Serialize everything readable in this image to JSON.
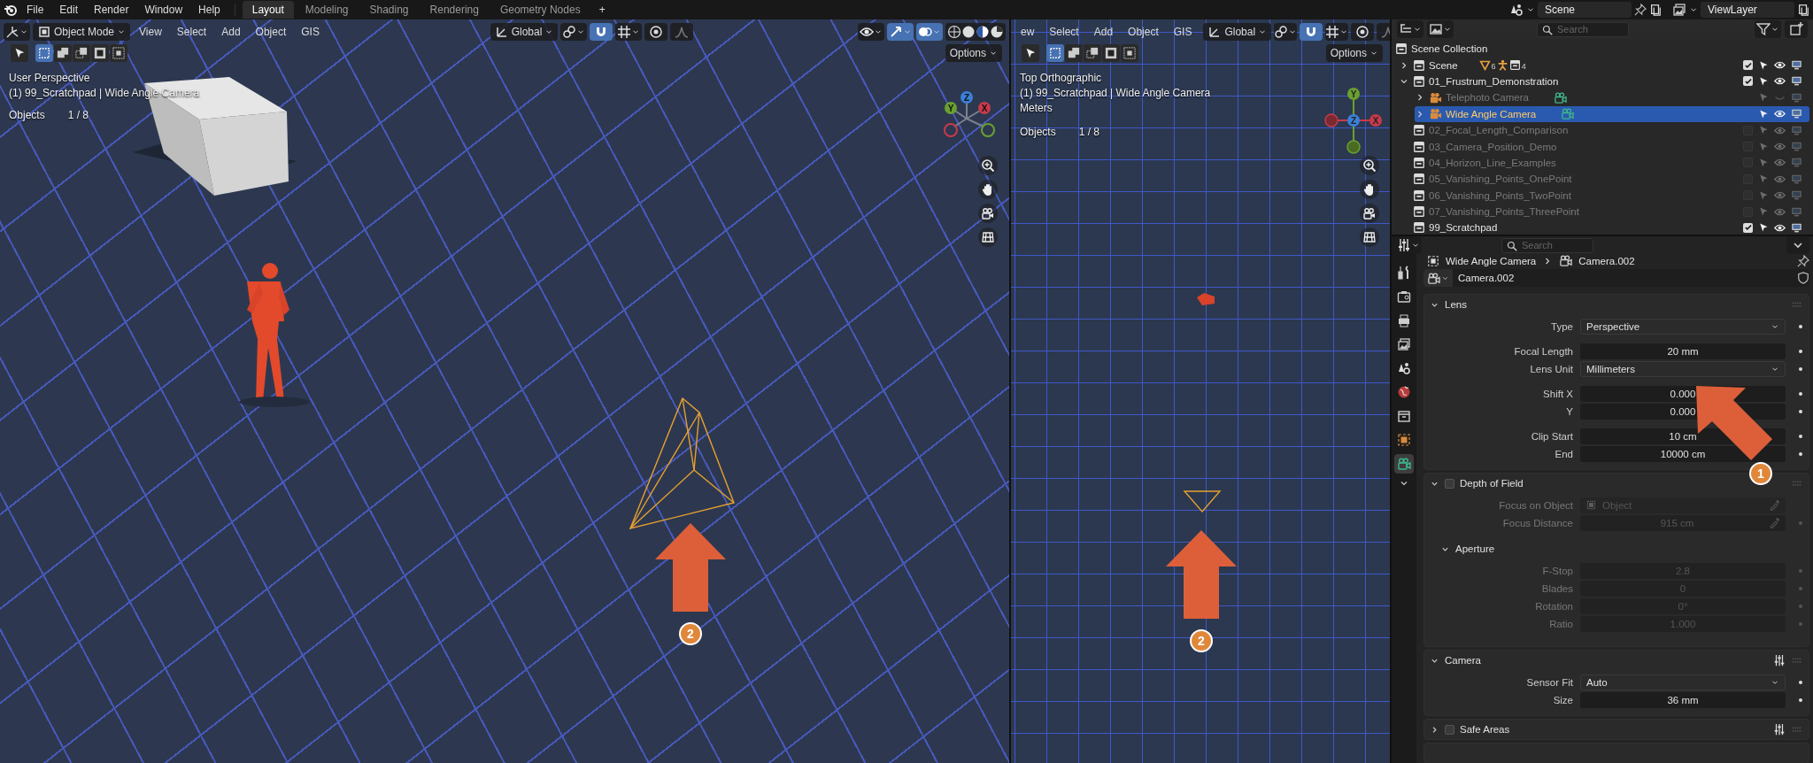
{
  "top_bar": {
    "menus": [
      "File",
      "Edit",
      "Render",
      "Window",
      "Help"
    ],
    "workspaces": [
      {
        "label": "Layout",
        "selected": true
      },
      {
        "label": "Modeling",
        "selected": false
      },
      {
        "label": "Shading",
        "selected": false
      },
      {
        "label": "Rendering",
        "selected": false
      },
      {
        "label": "Geometry Nodes",
        "selected": false
      }
    ],
    "add_tab": "+",
    "scene": "Scene",
    "view_layer": "ViewLayer"
  },
  "viewports": [
    {
      "kind": "perspective",
      "mode": "Object Mode",
      "menus": [
        "View",
        "Select",
        "Add",
        "Object",
        "GIS"
      ],
      "orientation": "Global",
      "options": "Options",
      "info": [
        "User Perspective",
        "(1) 99_Scratchpad | Wide Angle Camera"
      ],
      "objects_label": "Objects",
      "objects_count": "1 / 8",
      "gizmo": [
        "X",
        "Y",
        "Z"
      ],
      "badge": "2"
    },
    {
      "kind": "top",
      "menus": [
        "ew",
        "Select",
        "Add",
        "Object",
        "GIS"
      ],
      "orientation": "Global",
      "options": "Options",
      "info": [
        "Top Orthographic",
        "(1) 99_Scratchpad | Wide Angle Camera",
        "Meters"
      ],
      "objects_label": "Objects",
      "objects_count": "1 / 8",
      "gizmo": [
        "X",
        "Y",
        "Z"
      ],
      "badge": "2"
    }
  ],
  "outliner": {
    "search_placeholder": "Search",
    "root": {
      "label": "Scene Collection",
      "children": [
        {
          "label": "Scene",
          "kind": "collection",
          "expanded": false,
          "counts": [
            "6",
            "4"
          ],
          "checked": true,
          "visible": true,
          "selected": false
        },
        {
          "label": "01_Frustrum_Demonstration",
          "kind": "collection",
          "expanded": true,
          "checked": true,
          "visible": true,
          "selected": false,
          "children": [
            {
              "label": "Telephoto Camera",
              "kind": "camera",
              "expanded": false,
              "visible": false,
              "selected": false
            },
            {
              "label": "Wide Angle Camera",
              "kind": "camera",
              "expanded": false,
              "visible": true,
              "selected": true
            }
          ]
        },
        {
          "label": "02_Focal_Length_Comparison",
          "kind": "collection",
          "checked": false,
          "visible": true,
          "selected": false
        },
        {
          "label": "03_Camera_Position_Demo",
          "kind": "collection",
          "checked": false,
          "visible": true,
          "selected": false
        },
        {
          "label": "04_Horizon_Line_Examples",
          "kind": "collection",
          "checked": false,
          "visible": true,
          "selected": false
        },
        {
          "label": "05_Vanishing_Points_OnePoint",
          "kind": "collection",
          "checked": false,
          "visible": true,
          "selected": false
        },
        {
          "label": "06_Vanishing_Points_TwoPoint",
          "kind": "collection",
          "checked": false,
          "visible": true,
          "selected": false
        },
        {
          "label": "07_Vanishing_Points_ThreePoint",
          "kind": "collection",
          "checked": false,
          "visible": true,
          "selected": false
        },
        {
          "label": "99_Scratchpad",
          "kind": "collection",
          "checked": true,
          "visible": true,
          "selected": false
        }
      ]
    }
  },
  "properties": {
    "search_placeholder": "Search",
    "tabs": [
      {
        "kind": "tool",
        "selected": false
      },
      {
        "kind": "render",
        "selected": false
      },
      {
        "kind": "output",
        "selected": false
      },
      {
        "kind": "view_layer",
        "selected": false
      },
      {
        "kind": "scene",
        "selected": false
      },
      {
        "kind": "world",
        "selected": false
      },
      {
        "kind": "collection",
        "selected": false
      },
      {
        "kind": "object",
        "selected": false
      },
      {
        "kind": "data",
        "selected": true
      }
    ],
    "breadcrumb": [
      "Wide Angle Camera",
      "Camera.002"
    ],
    "datablock": "Camera.002",
    "annotation": "1",
    "panels": [
      {
        "title": "Lens",
        "expanded": true,
        "groups": [
          [
            {
              "label": "Type",
              "kind": "dropdown",
              "value": "Perspective"
            }
          ],
          [
            {
              "label": "Focal Length",
              "kind": "number",
              "value": "20 mm"
            },
            {
              "label": "Lens Unit",
              "kind": "dropdown",
              "value": "Millimeters"
            }
          ],
          [
            {
              "label": "Shift X",
              "kind": "number",
              "value": "0.000"
            },
            {
              "label": "Y",
              "kind": "number",
              "value": "0.000"
            }
          ],
          [
            {
              "label": "Clip Start",
              "kind": "number",
              "value": "10 cm"
            },
            {
              "label": "End",
              "kind": "number",
              "value": "10000 cm"
            }
          ]
        ]
      },
      {
        "title": "Depth of Field",
        "expanded": true,
        "enabled": false,
        "groups": [
          [
            {
              "label": "Focus on Object",
              "kind": "object",
              "placeholder": "Object"
            },
            {
              "label": "Focus Distance",
              "kind": "picker",
              "value": "915 cm"
            }
          ]
        ],
        "subpanels": [
          {
            "title": "Aperture",
            "expanded": true,
            "groups": [
              [
                {
                  "label": "F-Stop",
                  "kind": "number",
                  "value": "2.8"
                },
                {
                  "label": "Blades",
                  "kind": "number",
                  "value": "0"
                },
                {
                  "label": "Rotation",
                  "kind": "number",
                  "value": "0°"
                },
                {
                  "label": "Ratio",
                  "kind": "number",
                  "value": "1.000"
                }
              ]
            ]
          }
        ]
      },
      {
        "title": "Camera",
        "expanded": true,
        "presets": true,
        "groups": [
          [
            {
              "label": "Sensor Fit",
              "kind": "dropdown",
              "value": "Auto"
            },
            {
              "label": "Size",
              "kind": "number",
              "value": "36 mm"
            }
          ]
        ]
      },
      {
        "title": "Safe Areas",
        "expanded": false,
        "enabled": false,
        "presets": true
      }
    ]
  }
}
